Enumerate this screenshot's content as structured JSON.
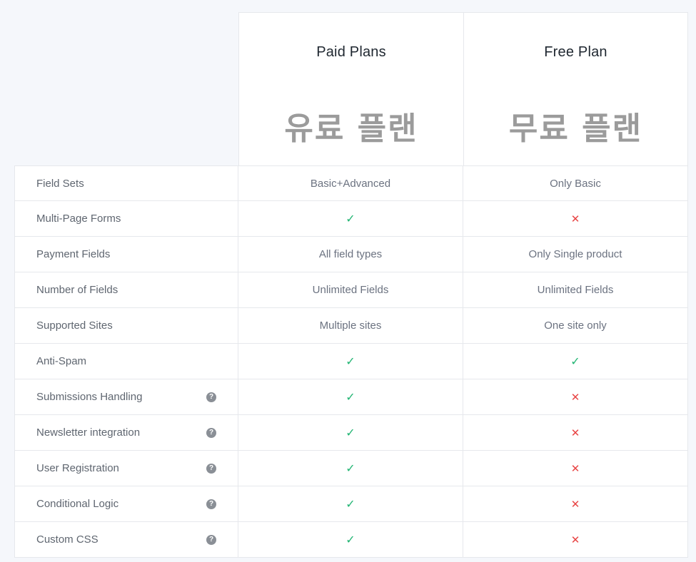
{
  "plans": {
    "paid": {
      "title": "Paid Plans",
      "korean": "유료 플랜"
    },
    "free": {
      "title": "Free Plan",
      "korean": "무료 플랜"
    }
  },
  "icons": {
    "check": "✓",
    "cross": "✕",
    "help": "?"
  },
  "colors": {
    "check": "#22b573",
    "cross": "#e84545",
    "help": "#8a8f96"
  },
  "rows": [
    {
      "feature": "Field Sets",
      "help": false,
      "paid": {
        "type": "text",
        "value": "Basic+Advanced"
      },
      "free": {
        "type": "text",
        "value": "Only Basic"
      }
    },
    {
      "feature": "Multi-Page Forms",
      "help": false,
      "paid": {
        "type": "check"
      },
      "free": {
        "type": "cross"
      }
    },
    {
      "feature": "Payment Fields",
      "help": false,
      "paid": {
        "type": "text",
        "value": "All field types"
      },
      "free": {
        "type": "text",
        "value": "Only Single product"
      }
    },
    {
      "feature": "Number of Fields",
      "help": false,
      "paid": {
        "type": "text",
        "value": "Unlimited Fields"
      },
      "free": {
        "type": "text",
        "value": "Unlimited Fields"
      }
    },
    {
      "feature": "Supported Sites",
      "help": false,
      "paid": {
        "type": "text",
        "value": "Multiple sites"
      },
      "free": {
        "type": "text",
        "value": "One site only"
      }
    },
    {
      "feature": "Anti-Spam",
      "help": false,
      "paid": {
        "type": "check"
      },
      "free": {
        "type": "check"
      }
    },
    {
      "feature": "Submissions Handling",
      "help": true,
      "paid": {
        "type": "check"
      },
      "free": {
        "type": "cross"
      }
    },
    {
      "feature": "Newsletter integration",
      "help": true,
      "paid": {
        "type": "check"
      },
      "free": {
        "type": "cross"
      }
    },
    {
      "feature": "User Registration",
      "help": true,
      "paid": {
        "type": "check"
      },
      "free": {
        "type": "cross"
      }
    },
    {
      "feature": "Conditional Logic",
      "help": true,
      "paid": {
        "type": "check"
      },
      "free": {
        "type": "cross"
      }
    },
    {
      "feature": "Custom CSS",
      "help": true,
      "paid": {
        "type": "check"
      },
      "free": {
        "type": "cross"
      }
    }
  ]
}
